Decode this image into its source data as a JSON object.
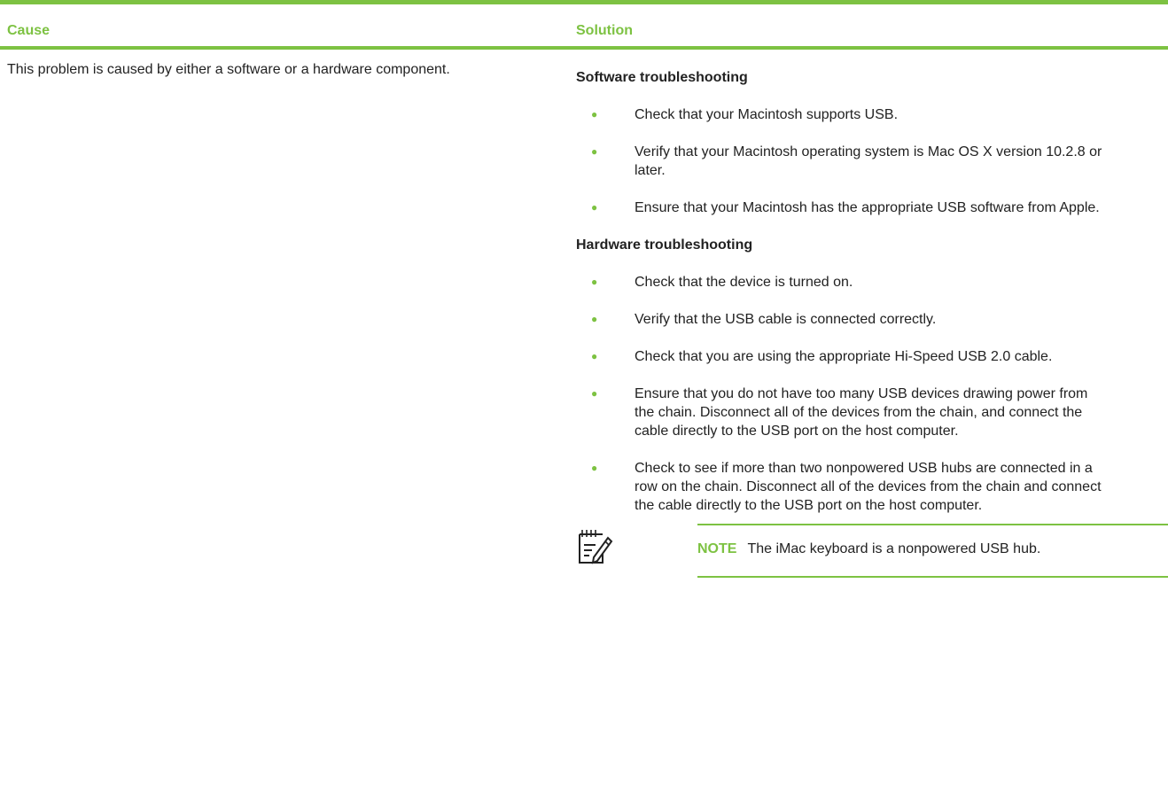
{
  "header": {
    "cause": "Cause",
    "solution": "Solution"
  },
  "cause": {
    "text": "This problem is caused by either a software or a hardware component."
  },
  "solution": {
    "software_heading": "Software troubleshooting",
    "software_items": [
      "Check that your Macintosh supports USB.",
      "Verify that your Macintosh operating system is Mac OS X version 10.2.8 or later.",
      "Ensure that your Macintosh has the appropriate USB software from Apple."
    ],
    "hardware_heading": "Hardware troubleshooting",
    "hardware_items": [
      "Check that the device is turned on.",
      "Verify that the USB cable is connected correctly.",
      "Check that you are using the appropriate Hi-Speed USB 2.0 cable.",
      "Ensure that you do not have too many USB devices drawing power from the chain. Disconnect all of the devices from the chain, and connect the cable directly to the USB port on the host computer.",
      "Check to see if more than two nonpowered USB hubs are connected in a row on the chain. Disconnect all of the devices from the chain and connect the cable directly to the USB port on the host computer."
    ],
    "bullet_glyph": "●"
  },
  "note": {
    "label": "NOTE",
    "text": "The iMac keyboard is a nonpowered USB hub.",
    "icon": "note-pad-icon"
  },
  "colors": {
    "accent": "#7dc242",
    "text": "#222222"
  }
}
